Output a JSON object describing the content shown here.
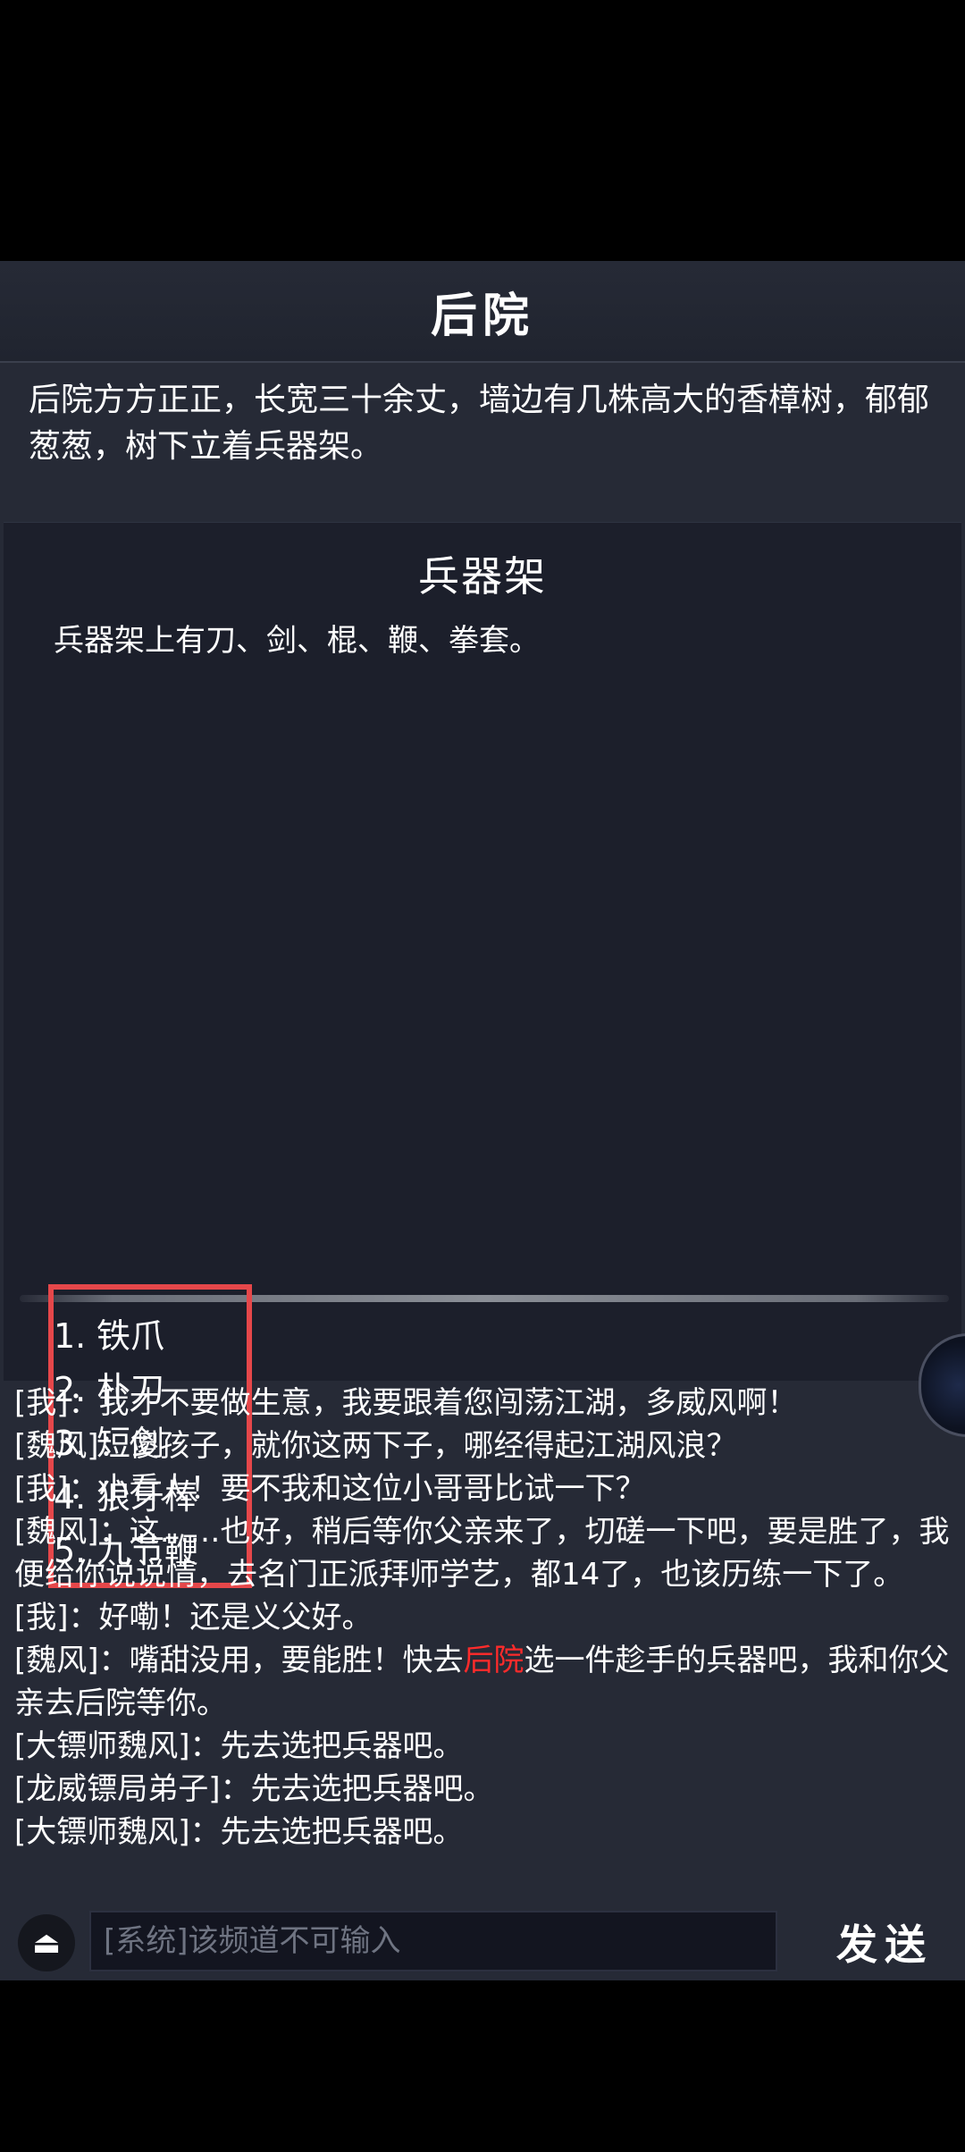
{
  "room": {
    "title": "后院",
    "description": "后院方方正正，长宽三十余丈，墙边有几株高大的香樟树，郁郁葱葱，树下立着兵器架。"
  },
  "panel": {
    "title": "兵器架",
    "description": "兵器架上有刀、剑、棍、鞭、拳套。",
    "items": [
      {
        "num": "1.",
        "label": "铁爪"
      },
      {
        "num": "2.",
        "label": "朴刀"
      },
      {
        "num": "3.",
        "label": "短剑"
      },
      {
        "num": "4.",
        "label": "狼牙棒"
      },
      {
        "num": "5.",
        "label": "九节鞭"
      }
    ],
    "highlight_color": "#e5474a"
  },
  "chat": {
    "messages": [
      {
        "speaker": "[我]",
        "text": "：我才不要做生意，我要跟着您闯荡江湖，多威风啊！"
      },
      {
        "speaker": "[魏风]",
        "text": "：傻孩子，就你这两下子，哪经得起江湖风浪？"
      },
      {
        "speaker": "[我]",
        "text": "：小看人！要不我和这位小哥哥比试一下？"
      },
      {
        "speaker": "[魏风]",
        "text": "：这……也好，稍后等你父亲来了，切磋一下吧，要是胜了，我便给你说说情，去名门正派拜师学艺，都14了，也该历练一下了。"
      },
      {
        "speaker": "[我]",
        "text": "：好嘞！还是义父好。"
      },
      {
        "speaker": "[魏风]",
        "text": "：嘴甜没用，要能胜！快去",
        "link": "后院",
        "text_after": "选一件趁手的兵器吧，我和你父亲去后院等你。"
      },
      {
        "speaker": "[大镖师魏风]",
        "text": "：先去选把兵器吧。"
      },
      {
        "speaker": "[龙威镖局弟子]",
        "text": "：先去选把兵器吧。"
      },
      {
        "speaker": "[大镖师魏风]",
        "text": "：先去选把兵器吧。"
      }
    ],
    "link_color": "#ff2b2b"
  },
  "input": {
    "placeholder": "[系统]该频道不可输入",
    "send_label": "发送",
    "channel_icon": "eject-icon"
  }
}
